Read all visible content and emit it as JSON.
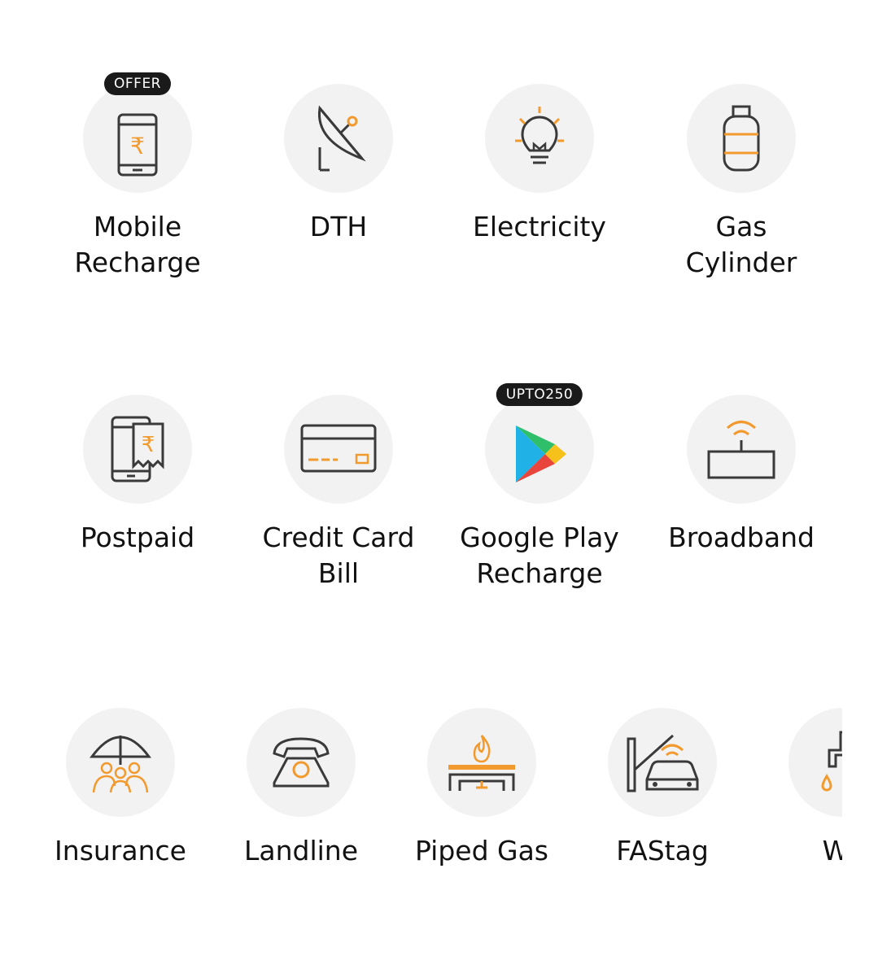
{
  "colors": {
    "accent": "#f29a2e",
    "icon_stroke": "#3a3a3a",
    "circle_bg": "#f2f2f2",
    "badge_bg": "#1a1a1a"
  },
  "row1": [
    {
      "label": "Mobile Recharge",
      "lines": [
        "Mobile",
        "Recharge"
      ],
      "badge": "OFFER",
      "icon": "mobile-rupee-icon"
    },
    {
      "label": "DTH",
      "lines": [
        "DTH"
      ],
      "icon": "satellite-dish-icon"
    },
    {
      "label": "Electricity",
      "lines": [
        "Electricity"
      ],
      "icon": "light-bulb-icon"
    },
    {
      "label": "Gas Cylinder",
      "lines": [
        "Gas",
        "Cylinder"
      ],
      "icon": "gas-cylinder-icon"
    }
  ],
  "row2": [
    {
      "label": "Postpaid",
      "lines": [
        "Postpaid"
      ],
      "icon": "postpaid-bill-icon"
    },
    {
      "label": "Credit Card Bill",
      "lines": [
        "Credit Card",
        "Bill"
      ],
      "icon": "credit-card-icon"
    },
    {
      "label": "Google Play Recharge",
      "lines": [
        "Google Play",
        "Recharge"
      ],
      "badge": "UPTO250",
      "icon": "google-play-icon"
    },
    {
      "label": "Broadband",
      "lines": [
        "Broadband"
      ],
      "icon": "router-wifi-icon"
    }
  ],
  "row3": [
    {
      "label": "Insurance",
      "lines": [
        "Insurance"
      ],
      "icon": "umbrella-family-icon"
    },
    {
      "label": "Landline",
      "lines": [
        "Landline"
      ],
      "icon": "telephone-icon"
    },
    {
      "label": "Piped Gas",
      "lines": [
        "Piped Gas"
      ],
      "icon": "gas-flame-pipe-icon"
    },
    {
      "label": "FAStag",
      "lines": [
        "FAStag"
      ],
      "icon": "toll-car-icon"
    },
    {
      "label": "Wa",
      "lines": [
        "Wa"
      ],
      "icon": "water-tap-icon"
    }
  ]
}
